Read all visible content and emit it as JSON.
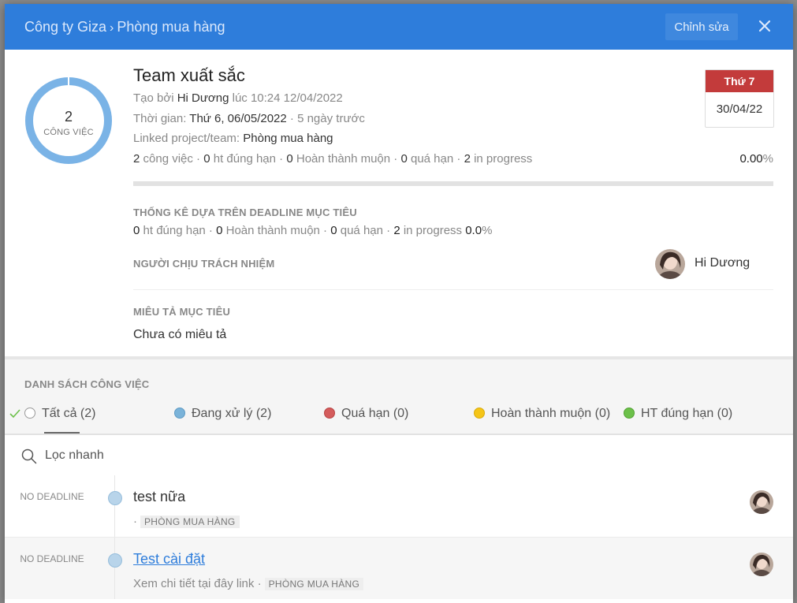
{
  "header": {
    "company": "Công ty Giza",
    "separator": "›",
    "department": "Phòng mua hàng",
    "edit_label": "Chỉnh sửa"
  },
  "summary": {
    "task_count": "2",
    "task_count_label": "CÔNG VIỆC"
  },
  "goal": {
    "title": "Team xuất sắc",
    "created_prefix": "Tạo bởi",
    "created_by": "Hi Dương",
    "created_at": "lúc 10:24 12/04/2022",
    "time_label": "Thời gian:",
    "time_value": "Thứ 6, 06/05/2022",
    "time_relative": "· 5 ngày trước",
    "linked_label": "Linked project/team:",
    "linked_value": "Phòng mua hàng",
    "stats": {
      "total": "2",
      "total_label": "công việc",
      "on_time": "0",
      "on_time_label": "ht đúng hạn",
      "late_done": "0",
      "late_done_label": "Hoàn thành muộn",
      "overdue": "0",
      "overdue_label": "quá hạn",
      "in_progress": "2",
      "in_progress_label": "in progress"
    },
    "percent": "0.00",
    "percent_sign": "%",
    "progress_fraction": 0
  },
  "deadline": {
    "weekday": "Thứ 7",
    "date": "30/04/22"
  },
  "deadline_stats": {
    "heading": "THỐNG KÊ DỰA TRÊN DEADLINE MỤC TIÊU",
    "on_time": "0",
    "on_time_label": "ht đúng hạn",
    "late_done": "0",
    "late_done_label": "Hoàn thành muộn",
    "overdue": "0",
    "overdue_label": "quá hạn",
    "in_progress": "2",
    "in_progress_label": "in progress",
    "percent": "0.0",
    "percent_sign": "%"
  },
  "owner": {
    "heading": "NGƯỜI CHỊU TRÁCH NHIỆM",
    "name": "Hi Dương"
  },
  "description": {
    "heading": "MIÊU TẢ MỤC TIÊU",
    "text": "Chưa có miêu tả"
  },
  "task_list": {
    "heading": "DANH SÁCH CÔNG VIỆC",
    "filters": [
      {
        "label": "Tất cả (2)",
        "color": "#ffffff"
      },
      {
        "label": "Đang xử lý (2)",
        "color": "#7ab3d9"
      },
      {
        "label": "Quá hạn (0)",
        "color": "#d45c5c"
      },
      {
        "label": "Hoàn thành muộn (0)",
        "color": "#f5c518"
      },
      {
        "label": "HT đúng hạn (0)",
        "color": "#6cc04a"
      }
    ]
  },
  "search": {
    "placeholder": "Lọc nhanh"
  },
  "tasks": [
    {
      "deadline": "NO DEADLINE",
      "name": "test nữa",
      "note": "·",
      "tag": "PHÒNG MUA HÀNG"
    },
    {
      "deadline": "NO DEADLINE",
      "name": "Test cài đặt",
      "note": "Xem chi tiết tại đây link ·",
      "tag": "PHÒNG MUA HÀNG"
    }
  ],
  "colors": {
    "header_blue": "#2e7ddb",
    "donut_ring": "#7ab3e6",
    "deadline_red": "#c33b3b"
  }
}
